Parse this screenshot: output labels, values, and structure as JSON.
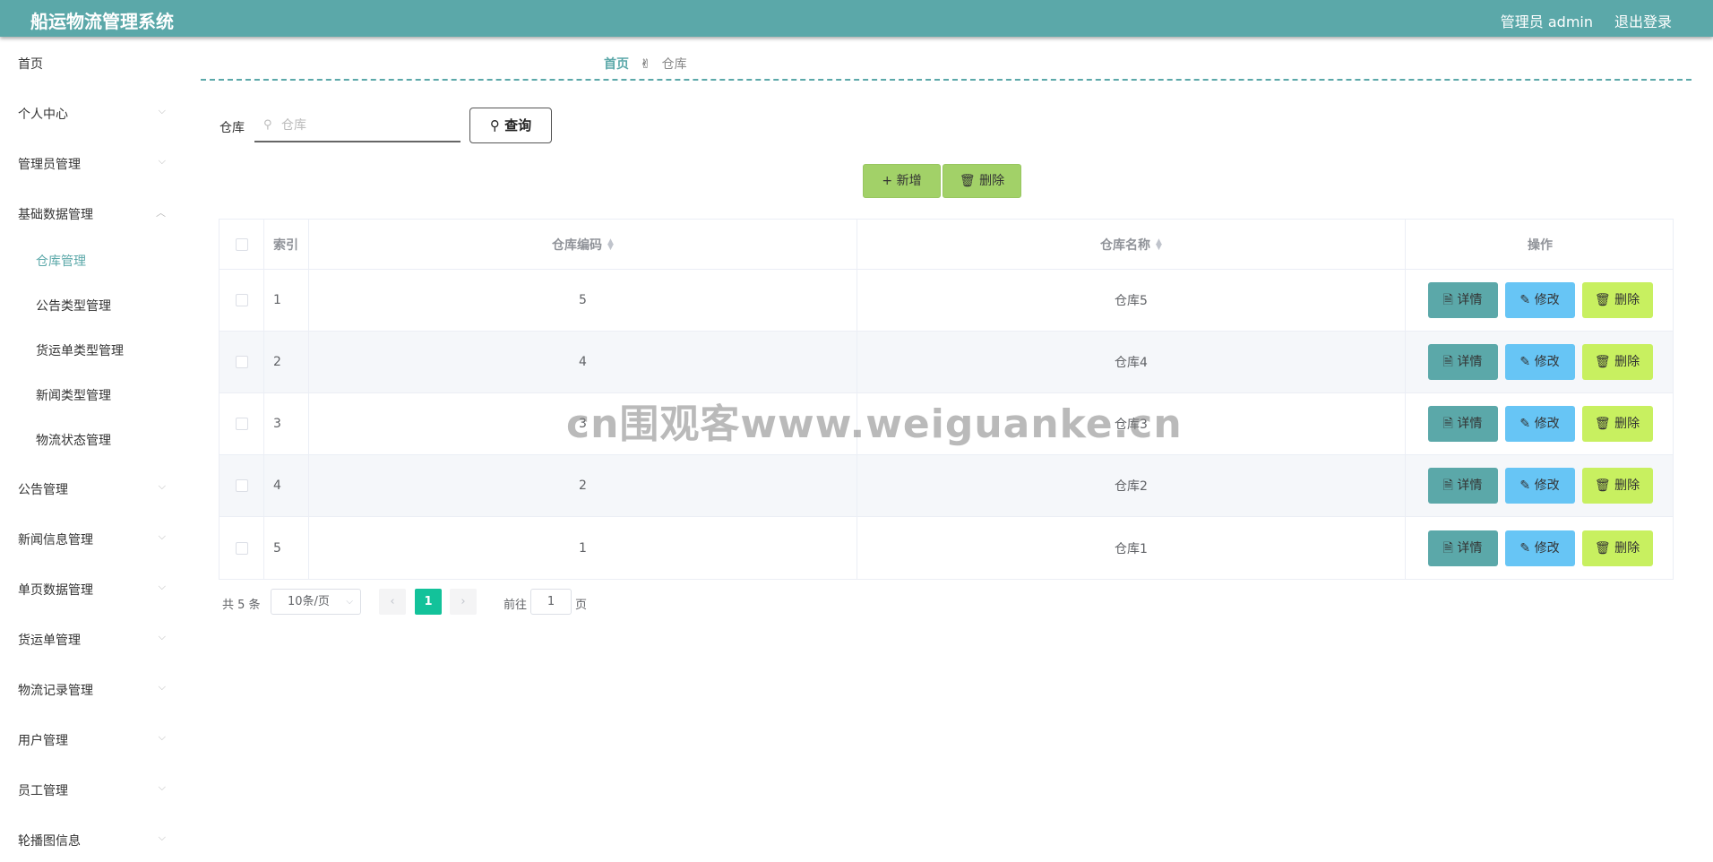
{
  "header": {
    "title": "船运物流管理系统",
    "user": "管理员 admin",
    "logout": "退出登录"
  },
  "sidebar": {
    "items": [
      {
        "label": "首页",
        "chevron": false
      },
      {
        "label": "个人中心",
        "chevron": true
      },
      {
        "label": "管理员管理",
        "chevron": true
      },
      {
        "label": "基础数据管理",
        "chevron": true,
        "expanded": true
      },
      {
        "label": "公告管理",
        "chevron": true
      },
      {
        "label": "新闻信息管理",
        "chevron": true
      },
      {
        "label": "单页数据管理",
        "chevron": true
      },
      {
        "label": "货运单管理",
        "chevron": true
      },
      {
        "label": "物流记录管理",
        "chevron": true
      },
      {
        "label": "用户管理",
        "chevron": true
      },
      {
        "label": "员工管理",
        "chevron": true
      },
      {
        "label": "轮播图信息",
        "chevron": true
      }
    ],
    "sub_items": [
      {
        "label": "仓库管理",
        "active": true
      },
      {
        "label": "公告类型管理"
      },
      {
        "label": "货运单类型管理"
      },
      {
        "label": "新闻类型管理"
      },
      {
        "label": "物流状态管理"
      }
    ]
  },
  "breadcrumb": {
    "home": "首页",
    "current": "仓库"
  },
  "search": {
    "label": "仓库",
    "placeholder": "仓库",
    "value": "",
    "button": "查询"
  },
  "actions": {
    "add": "新增",
    "delete": "删除"
  },
  "table": {
    "headers": {
      "index": "索引",
      "code": "仓库编码",
      "name": "仓库名称",
      "ops": "操作"
    },
    "rows": [
      {
        "index": "1",
        "code": "5",
        "name": "仓库5"
      },
      {
        "index": "2",
        "code": "4",
        "name": "仓库4"
      },
      {
        "index": "3",
        "code": "3",
        "name": "仓库3"
      },
      {
        "index": "4",
        "code": "2",
        "name": "仓库2"
      },
      {
        "index": "5",
        "code": "1",
        "name": "仓库1"
      }
    ],
    "op_labels": {
      "detail": "详情",
      "edit": "修改",
      "delete": "删除"
    }
  },
  "pagination": {
    "total": "共 5 条",
    "page_size": "10条/页",
    "current": "1",
    "goto_label": "前往",
    "goto_value": "1",
    "page_unit": "页"
  },
  "watermark": "cn围观客www.weiguanke.cn",
  "colors": {
    "primary": "#5ba8a9",
    "add_button": "#a2d168",
    "detail_button": "#5ba8a9",
    "edit_button": "#67c5f5",
    "delete_button": "#c8f060",
    "pager_active": "#13c29a"
  }
}
